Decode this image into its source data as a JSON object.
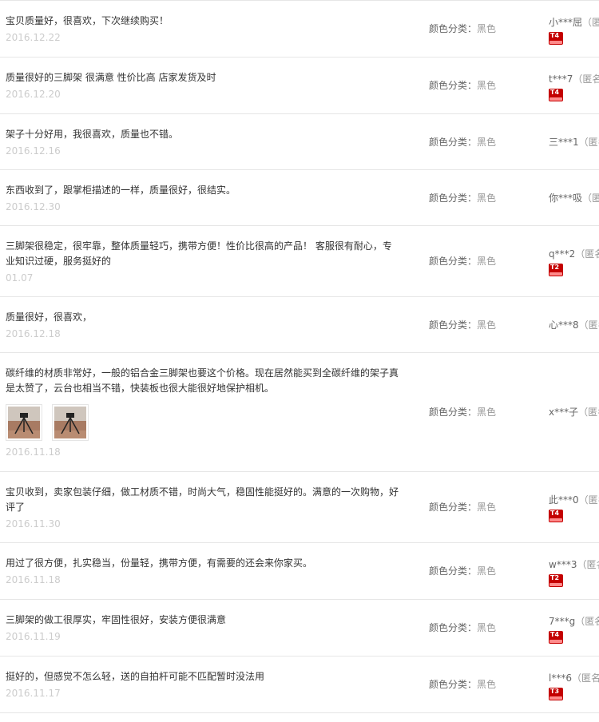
{
  "sku_label": "颜色分类：",
  "reviews": [
    {
      "text": "宝贝质量好，很喜欢，下次继续购买！",
      "date": "2016.12.22",
      "sku_value": "黑色",
      "user": "小***屈",
      "anon": "（匿名）",
      "level": "T4",
      "images": 0
    },
    {
      "text": "质量很好的三脚架 很满意 性价比高 店家发货及时",
      "date": "2016.12.20",
      "sku_value": "黑色",
      "user": "t***7",
      "anon": "（匿名）",
      "level": "T4",
      "images": 0
    },
    {
      "text": "架子十分好用，我很喜欢，质量也不错。",
      "date": "2016.12.16",
      "sku_value": "黑色",
      "user": "三***1",
      "anon": "（匿名）",
      "level": "",
      "images": 0
    },
    {
      "text": "东西收到了，跟掌柜描述的一样，质量很好，很结实。",
      "date": "2016.12.30",
      "sku_value": "黑色",
      "user": "你***吸",
      "anon": "（匿名）",
      "level": "",
      "images": 0
    },
    {
      "text": "三脚架很稳定，很牢靠，整体质量轻巧，携带方便！性价比很高的产品！ 客服很有耐心，专业知识过硬，服务挺好的",
      "date": "01.07",
      "sku_value": "黑色",
      "user": "q***2",
      "anon": "（匿名）",
      "level": "T2",
      "images": 0
    },
    {
      "text": "质量很好，很喜欢，",
      "date": "2016.12.18",
      "sku_value": "黑色",
      "user": "心***8",
      "anon": "（匿名）",
      "level": "",
      "images": 0
    },
    {
      "text": "碳纤维的材质非常好，一般的铝合金三脚架也要这个价格。现在居然能买到全碳纤维的架子真是太赞了，云台也相当不错，快装板也很大能很好地保护相机。",
      "date": "2016.11.18",
      "sku_value": "黑色",
      "user": "x***子",
      "anon": "（匿名）",
      "level": "",
      "images": 2
    },
    {
      "text": "宝贝收到，卖家包装仔细，做工材质不错，时尚大气，稳固性能挺好的。满意的一次购物，好评了",
      "date": "2016.11.30",
      "sku_value": "黑色",
      "user": "此***0",
      "anon": "（匿名）",
      "level": "T4",
      "images": 0
    },
    {
      "text": "用过了很方便，扎实稳当，份量轻，携带方便，有需要的还会来你家买。",
      "date": "2016.11.18",
      "sku_value": "黑色",
      "user": "w***3",
      "anon": "（匿名）",
      "level": "T2",
      "images": 0
    },
    {
      "text": "三脚架的做工很厚实，牢固性很好，安装方便很满意",
      "date": "2016.11.19",
      "sku_value": "黑色",
      "user": "7***g",
      "anon": "（匿名）",
      "level": "T4",
      "images": 0
    },
    {
      "text": "挺好的，但感觉不怎么轻，送的自拍杆可能不匹配暂时没法用",
      "date": "2016.11.17",
      "sku_value": "黑色",
      "user": "l***6",
      "anon": "（匿名）",
      "level": "T3",
      "images": 0
    }
  ]
}
